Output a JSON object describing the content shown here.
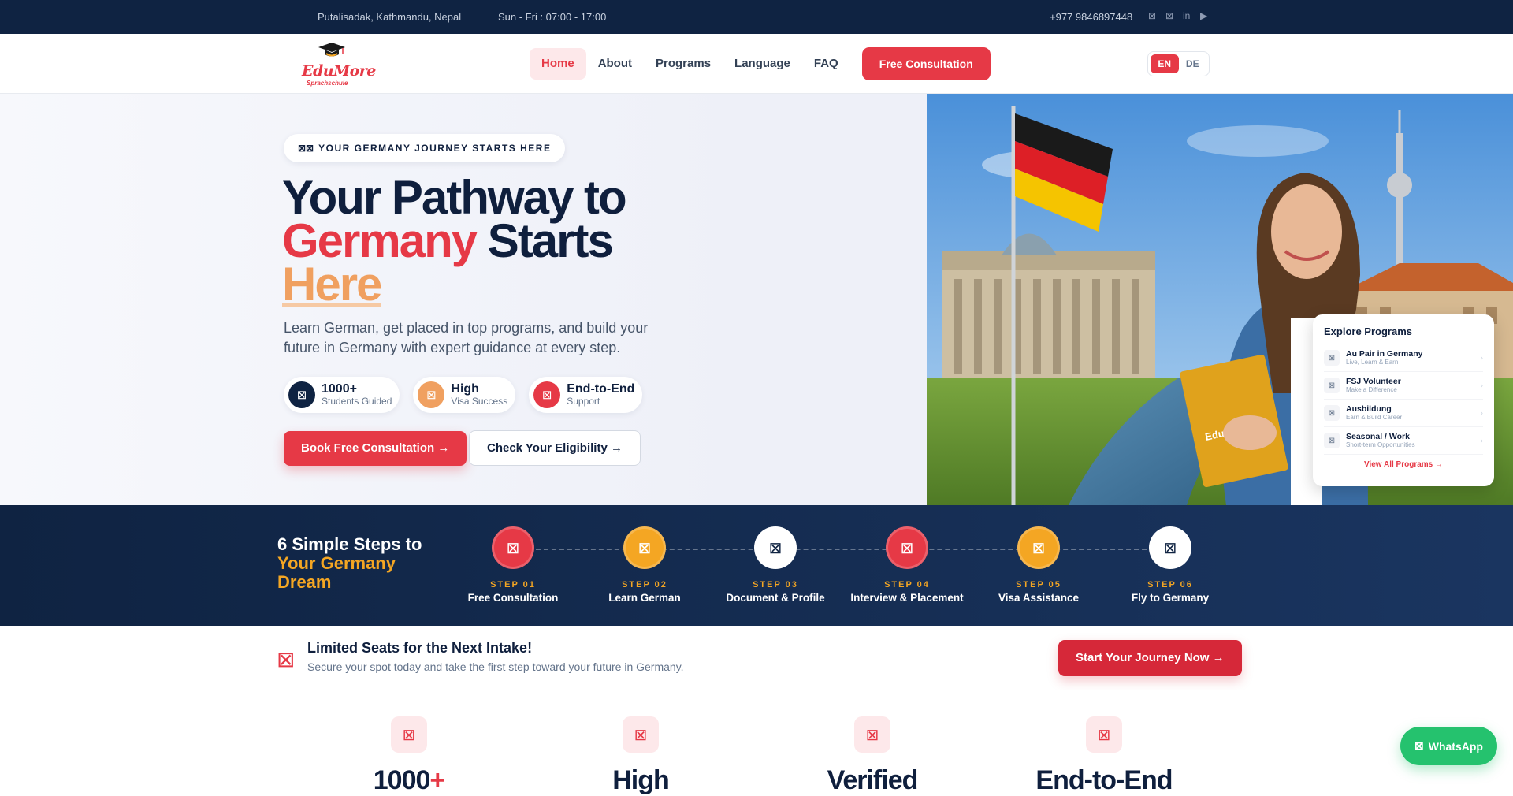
{
  "topbar": {
    "location": "Putalisadak, Kathmandu, Nepal",
    "hours": "Sun - Fri : 07:00 - 17:00",
    "phone": "+977 9846897448",
    "social": [
      {
        "name": "facebook-icon",
        "glyph": "⊠"
      },
      {
        "name": "instagram-icon",
        "glyph": "⊠"
      },
      {
        "name": "linkedin-icon",
        "glyph": "in"
      },
      {
        "name": "youtube-icon",
        "glyph": "▶"
      }
    ]
  },
  "nav": {
    "logo": {
      "brand": "EduMore",
      "sub": "Sprachschule"
    },
    "items": [
      {
        "label": "Home",
        "active": true
      },
      {
        "label": "About",
        "active": false
      },
      {
        "label": "Programs",
        "active": false
      },
      {
        "label": "Language",
        "active": false
      },
      {
        "label": "FAQ",
        "active": false
      }
    ],
    "cta": "Free Consultation",
    "languages": [
      {
        "code": "EN",
        "active": true
      },
      {
        "code": "DE",
        "active": false
      }
    ]
  },
  "hero": {
    "eyebrow": "YOUR GERMANY JOURNEY STARTS HERE",
    "eyebrow_icon": "⊠⊠",
    "title_line1": "Your Pathway to",
    "title_red": "Germany",
    "title_line2_rest": " Starts",
    "title_orange": "Here",
    "lead": "Learn German, get placed in top programs, and build your future in Germany with expert guidance at every step.",
    "stats": [
      {
        "title": "1000+",
        "sub": "Students Guided",
        "color": "#0f2342"
      },
      {
        "title": "High",
        "sub": "Visa Success",
        "color": "#f0a060"
      },
      {
        "title": "End-to-End",
        "sub": "Support",
        "color": "#e63946"
      }
    ],
    "primary_cta": "Book Free Consultation →",
    "secondary_cta": "Check Your Eligibility →"
  },
  "programs_card": {
    "title": "Explore Programs",
    "items": [
      {
        "name": "Au Pair in Germany",
        "sub": "Live, Learn & Earn"
      },
      {
        "name": "FSJ Volunteer",
        "sub": "Make a Difference"
      },
      {
        "name": "Ausbildung",
        "sub": "Earn & Build Career"
      },
      {
        "name": "Seasonal / Work",
        "sub": "Short-term Opportunities"
      }
    ],
    "view_all": "View All Programs →"
  },
  "steps": {
    "heading_white": "6 Simple Steps to",
    "heading_yellow": "Your Germany Dream",
    "items": [
      {
        "num": "STEP 01",
        "label": "Free Consultation",
        "color": "#e63946"
      },
      {
        "num": "STEP 02",
        "label": "Learn German",
        "color": "#f4a623"
      },
      {
        "num": "STEP 03",
        "label": "Document & Profile",
        "color": "#ffffff"
      },
      {
        "num": "STEP 04",
        "label": "Interview & Placement",
        "color": "#e63946"
      },
      {
        "num": "STEP 05",
        "label": "Visa Assistance",
        "color": "#f4a623"
      },
      {
        "num": "STEP 06",
        "label": "Fly to Germany",
        "color": "#ffffff"
      }
    ]
  },
  "banner": {
    "title": "Limited Seats for the Next Intake!",
    "sub": "Secure your spot today and take the first step toward your future in Germany.",
    "cta": "Start Your Journey Now →"
  },
  "features": [
    {
      "value": "1000",
      "suffix": "+"
    },
    {
      "value": "High",
      "suffix": ""
    },
    {
      "value": "Verified",
      "suffix": ""
    },
    {
      "value": "End-to-End",
      "suffix": ""
    }
  ],
  "whatsapp": {
    "label": "WhatsApp"
  },
  "photo_book_label": "EduMore"
}
